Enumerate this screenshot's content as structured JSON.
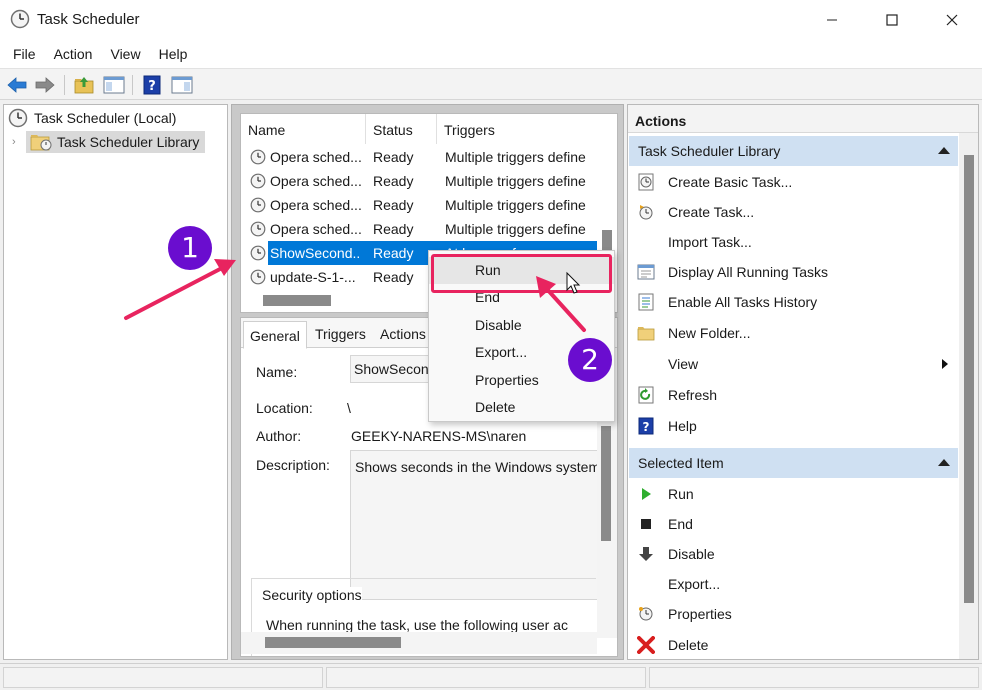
{
  "window": {
    "title": "Task Scheduler",
    "minimize_icon": "minimize-icon",
    "maximize_icon": "maximize-icon",
    "close_icon": "close-icon"
  },
  "menu": [
    "File",
    "Action",
    "View",
    "Help"
  ],
  "toolbar": [
    "back-arrow-icon",
    "forward-arrow-icon",
    "folder-up-icon",
    "show-hide-console-tree-icon",
    "help-icon",
    "action-pane-icon"
  ],
  "tree": {
    "root": "Task Scheduler (Local)",
    "library": "Task Scheduler Library"
  },
  "task_list": {
    "columns": [
      "Name",
      "Status",
      "Triggers"
    ],
    "rows": [
      {
        "name": "Opera sched...",
        "status": "Ready",
        "triggers": "Multiple triggers define"
      },
      {
        "name": "Opera sched...",
        "status": "Ready",
        "triggers": "Multiple triggers define"
      },
      {
        "name": "Opera sched...",
        "status": "Ready",
        "triggers": "Multiple triggers define"
      },
      {
        "name": "Opera sched...",
        "status": "Ready",
        "triggers": "Multiple triggers define"
      },
      {
        "name": "ShowSecond...",
        "status": "Ready",
        "triggers": "At log on of any user",
        "selected": true
      },
      {
        "name": "update-S-1-...",
        "status": "Ready",
        "triggers": ""
      }
    ]
  },
  "details": {
    "tabs": [
      "General",
      "Triggers",
      "Actions"
    ],
    "name_label": "Name:",
    "name_value": "ShowSeconds",
    "location_label": "Location:",
    "location_value": "\\",
    "author_label": "Author:",
    "author_value": "GEEKY-NARENS-MS\\naren",
    "description_label": "Description:",
    "description_value": "Shows seconds in the Windows system",
    "security_title": "Security options",
    "security_text": "When running the task, use the following user ac"
  },
  "context_menu": [
    "Run",
    "End",
    "Disable",
    "Export...",
    "Properties",
    "Delete"
  ],
  "actions_pane": {
    "title": "Actions",
    "library_section": "Task Scheduler Library",
    "library_items": [
      {
        "label": "Create Basic Task...",
        "icon": "create-basic-task-icon"
      },
      {
        "label": "Create Task...",
        "icon": "create-task-icon"
      },
      {
        "label": "Import Task...",
        "icon": ""
      },
      {
        "label": "Display All Running Tasks",
        "icon": "running-tasks-icon"
      },
      {
        "label": "Enable All Tasks History",
        "icon": "history-icon"
      },
      {
        "label": "New Folder...",
        "icon": "new-folder-icon"
      },
      {
        "label": "View",
        "icon": "",
        "submenu": true
      },
      {
        "label": "Refresh",
        "icon": "refresh-icon"
      },
      {
        "label": "Help",
        "icon": "help-icon"
      }
    ],
    "selected_section": "Selected Item",
    "selected_items": [
      {
        "label": "Run",
        "icon": "run-icon"
      },
      {
        "label": "End",
        "icon": "end-icon"
      },
      {
        "label": "Disable",
        "icon": "disable-icon"
      },
      {
        "label": "Export...",
        "icon": ""
      },
      {
        "label": "Properties",
        "icon": "properties-icon"
      },
      {
        "label": "Delete",
        "icon": "delete-icon"
      }
    ]
  },
  "annotations": {
    "badge_1": "1",
    "badge_2": "2",
    "accent": "#e8245f",
    "badge_color": "#6a0dcf"
  }
}
